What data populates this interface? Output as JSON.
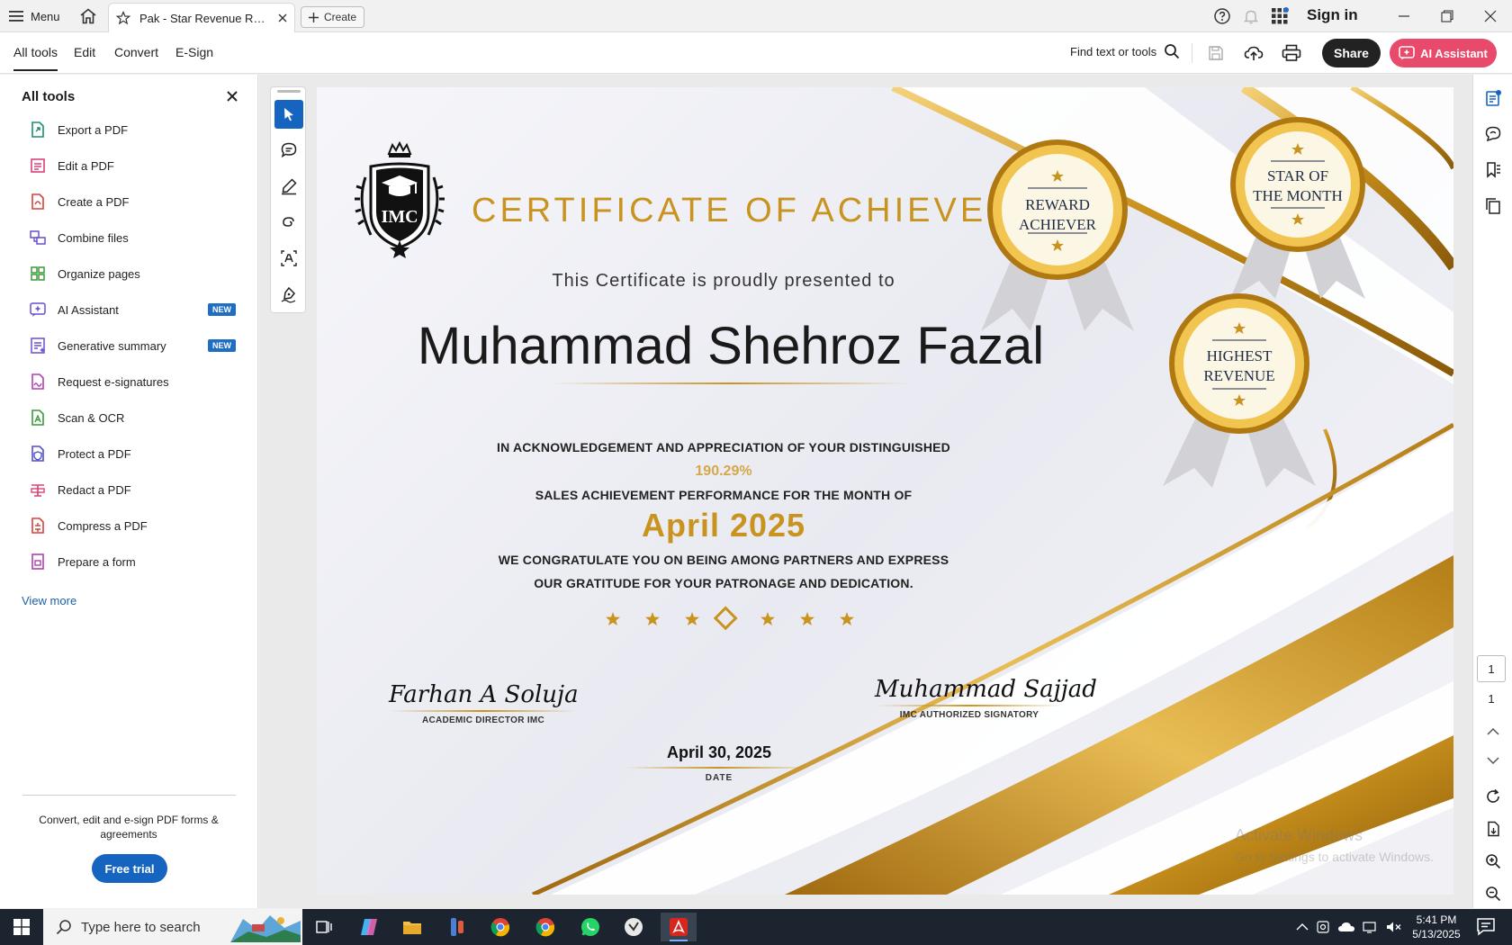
{
  "titlebar": {
    "menu_label": "Menu",
    "tab_title": "Pak - Star Revenue Rew...",
    "create_label": "Create",
    "signin_label": "Sign in"
  },
  "toolbar": {
    "tabs": [
      {
        "label": "All tools"
      },
      {
        "label": "Edit"
      },
      {
        "label": "Convert"
      },
      {
        "label": "E-Sign"
      }
    ],
    "find_label": "Find text or tools",
    "share_label": "Share",
    "ai_label": "AI Assistant"
  },
  "left_panel": {
    "title": "All tools",
    "items": [
      {
        "label": "Export a PDF",
        "icon": "export-pdf-icon",
        "color": "#1a8f6f"
      },
      {
        "label": "Edit a PDF",
        "icon": "edit-pdf-icon",
        "color": "#d8407a"
      },
      {
        "label": "Create a PDF",
        "icon": "create-pdf-icon",
        "color": "#d8403a"
      },
      {
        "label": "Combine files",
        "icon": "combine-files-icon",
        "color": "#6a4fcf"
      },
      {
        "label": "Organize pages",
        "icon": "organize-pages-icon",
        "color": "#3a9a3a"
      },
      {
        "label": "AI Assistant",
        "icon": "ai-assistant-icon",
        "color": "#6a4fcf",
        "badge": "NEW"
      },
      {
        "label": "Generative summary",
        "icon": "generative-summary-icon",
        "color": "#6a4fcf",
        "badge": "NEW"
      },
      {
        "label": "Request e-signatures",
        "icon": "request-esign-icon",
        "color": "#b040b0"
      },
      {
        "label": "Scan & OCR",
        "icon": "scan-ocr-icon",
        "color": "#3a9a3a"
      },
      {
        "label": "Protect a PDF",
        "icon": "protect-pdf-icon",
        "color": "#5050c8"
      },
      {
        "label": "Redact a PDF",
        "icon": "redact-pdf-icon",
        "color": "#d8407a"
      },
      {
        "label": "Compress a PDF",
        "icon": "compress-pdf-icon",
        "color": "#d8403a"
      },
      {
        "label": "Prepare a form",
        "icon": "prepare-form-icon",
        "color": "#b040b0"
      }
    ],
    "view_more": "View more",
    "promo_text": "Convert, edit and e-sign PDF forms & agreements",
    "free_trial_label": "Free trial"
  },
  "certificate": {
    "logo_text": "IMC",
    "title": "CERTIFICATE OF ACHIEVEMENT",
    "presented": "This Certificate is proudly presented to",
    "name": "Muhammad Shehroz Fazal",
    "line1": "IN ACKNOWLEDGEMENT AND APPRECIATION OF YOUR DISTINGUISHED",
    "percent": "190.29%",
    "line2": "SALES  ACHIEVEMENT PERFORMANCE FOR THE MONTH OF",
    "month": "April  2025",
    "line3": "WE CONGRATULATE YOU ON BEING AMONG PARTNERS AND EXPRESS",
    "line4": "OUR GRATITUDE FOR YOUR PATRONAGE AND DEDICATION.",
    "sig_left_name": "Farhan A Soluja",
    "sig_left_title": "ACADEMIC DIRECTOR IMC",
    "sig_right_name": "Muhammad Sajjad",
    "sig_right_title": "IMC AUTHORIZED SIGNATORY",
    "date": "April 30, 2025",
    "date_label": "DATE",
    "badges": {
      "reward_line1": "REWARD",
      "reward_line2": "ACHIEVER",
      "star_line1": "STAR OF",
      "star_line2": "THE MONTH",
      "revenue_line1": "HIGHEST",
      "revenue_line2": "REVENUE"
    },
    "gold": "#c8941f"
  },
  "watermark": {
    "line1": "Activate Windows",
    "line2": "Go to Settings to activate Windows."
  },
  "pager": {
    "current": "1",
    "total": "1"
  },
  "taskbar": {
    "search_placeholder": "Type here to search",
    "time": "5:41 PM",
    "date": "5/13/2025"
  }
}
